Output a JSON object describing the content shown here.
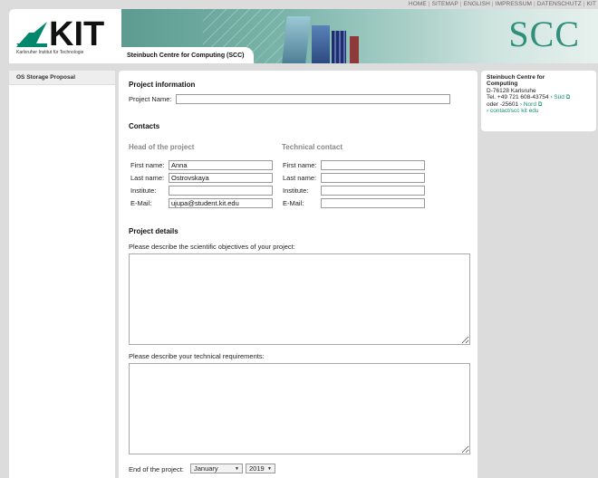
{
  "topnav": [
    "HOME",
    "SITEMAP",
    "ENGLISH",
    "IMPRESSUM",
    "DATENSCHUTZ",
    "KIT"
  ],
  "header": {
    "logo_text": "KIT",
    "logo_subtitle": "Karlsruher Institut für Technologie",
    "site_title": "Steinbuch Centre for Computing (SCC)",
    "scc_logo": "SCC"
  },
  "sidebar": {
    "items": [
      "OS Storage Proposal"
    ]
  },
  "form": {
    "project_info_heading": "Project information",
    "project_name_label": "Project Name:",
    "project_name_value": "",
    "contacts_heading": "Contacts",
    "head": {
      "title": "Head of the project",
      "first_name_label": "First name:",
      "first_name": "Anna",
      "last_name_label": "Last name:",
      "last_name": "Ostrovskaya",
      "institute_label": "Institute:",
      "institute": "",
      "email_label": "E-Mail:",
      "email": "ujupa@student.kit.edu"
    },
    "tech": {
      "title": "Technical contact",
      "first_name_label": "First name:",
      "first_name": "",
      "last_name_label": "Last name:",
      "last_name": "",
      "institute_label": "Institute:",
      "institute": "",
      "email_label": "E-Mail:",
      "email": ""
    },
    "details_heading": "Project details",
    "objectives_label": "Please describe the scientific objectives of your project:",
    "requirements_label": "Please describe your technical requirements:",
    "end_label": "End of the project:",
    "end_month": "January",
    "end_year": "2019"
  },
  "infobox": {
    "title_line1": "Steinbuch Centre for",
    "title_line2": "Computing",
    "address": "D-76128 Karlsruhe",
    "tel": "Tel. +49 721 608-43754",
    "link_sued": "› Süd ⧉",
    "oder": "oder -25601",
    "link_nord": "› Nord ⧉",
    "link_contact": "› contact/scc kit edu"
  },
  "colors": {
    "accent": "#1a8f73",
    "banner": "#5d9b90",
    "page_bg": "#dcdcdc"
  }
}
